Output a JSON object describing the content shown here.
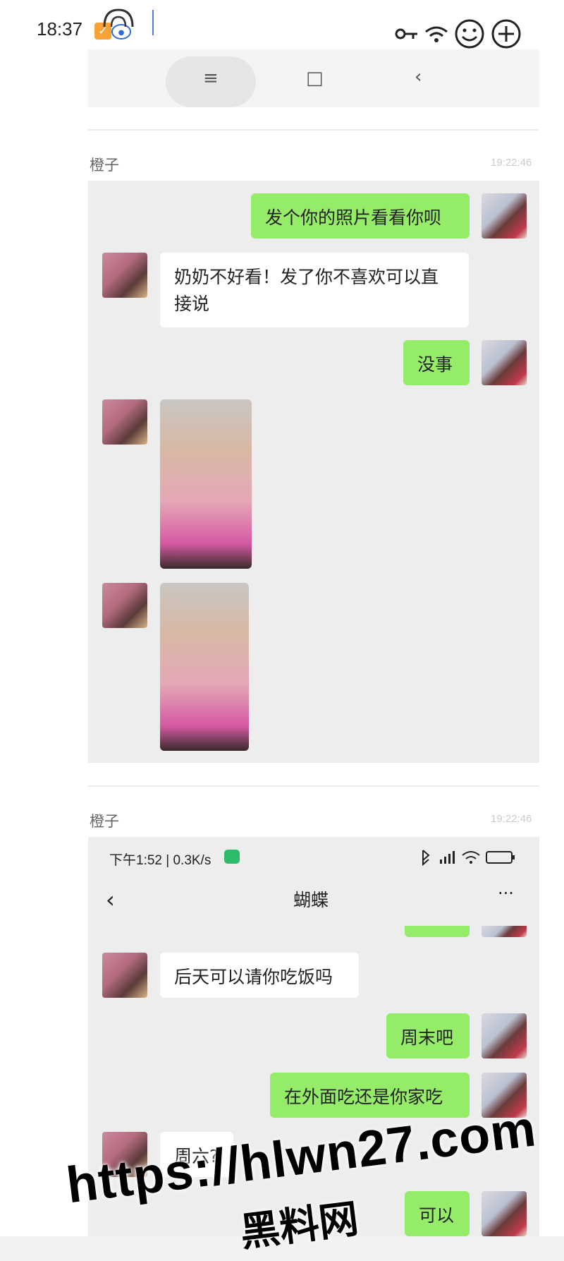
{
  "status_bar": {
    "time": "18:37"
  },
  "nav_bar": {
    "menu_icon": "≡",
    "home_icon": "□",
    "back_icon": "‹"
  },
  "screenshot_one": {
    "sender": "橙子",
    "timestamp": "19:22:46",
    "messages": [
      {
        "side": "me",
        "text": "发个你的照片看看你呗"
      },
      {
        "side": "her",
        "text": "奶奶不好看！发了你不喜欢可以直接说"
      },
      {
        "side": "me",
        "text": "没事"
      }
    ]
  },
  "screenshot_two": {
    "sender": "橙子",
    "timestamp": "19:22:46",
    "inner_status": "下午1:52 | 0.3K/s",
    "chat_title": "蝴蝶",
    "more_label": "···",
    "messages": [
      {
        "side": "her",
        "text": "后天可以请你吃饭吗"
      },
      {
        "side": "me",
        "text": "周末吧"
      },
      {
        "side": "me",
        "text": "在外面吃还是你家吃"
      },
      {
        "side": "her",
        "text": "周六?"
      },
      {
        "side": "me",
        "text": "可以"
      }
    ]
  },
  "watermark": {
    "url": "https://hlwn27.com",
    "name": "黑料网"
  }
}
